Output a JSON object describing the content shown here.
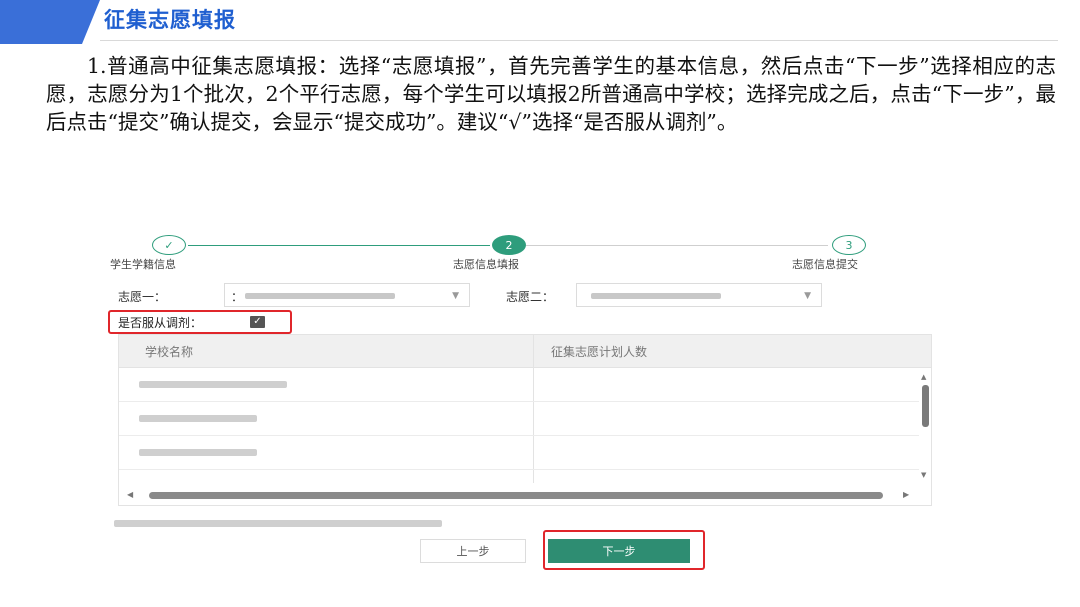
{
  "header": {
    "title": "征集志愿填报",
    "accent_color": "#3a6fd8"
  },
  "instruction_text": "1.普通高中征集志愿填报：选择“志愿填报”，首先完善学生的基本信息，然后点击“下一步”选择相应的志愿，志愿分为1个批次，2个平行志愿，每个学生可以填报2所普通高中学校；选择完成之后，点击“下一步”，最后点击“提交”确认提交，会显示“提交成功”。建议“√”选择“是否服从调剂”。",
  "stepper": {
    "steps": [
      {
        "label": "学生学籍信息",
        "marker": "✓",
        "state": "done"
      },
      {
        "label": "志愿信息填报",
        "marker": "2",
        "state": "active"
      },
      {
        "label": "志愿信息提交",
        "marker": "3",
        "state": "pending"
      }
    ],
    "color": "#2e9d7c"
  },
  "form": {
    "choice1_label": "志愿一：",
    "choice1_prefix": "：",
    "choice2_label": "志愿二：",
    "dropdown_icon": "chevron-down-icon",
    "adjust_label": "是否服从调剂：",
    "adjust_checked": true
  },
  "table": {
    "columns": [
      "学校名称",
      "征集志愿计划人数"
    ]
  },
  "buttons": {
    "prev": "上一步",
    "next": "下一步",
    "next_color": "#2e8d72",
    "highlight_color": "#e0262b"
  }
}
